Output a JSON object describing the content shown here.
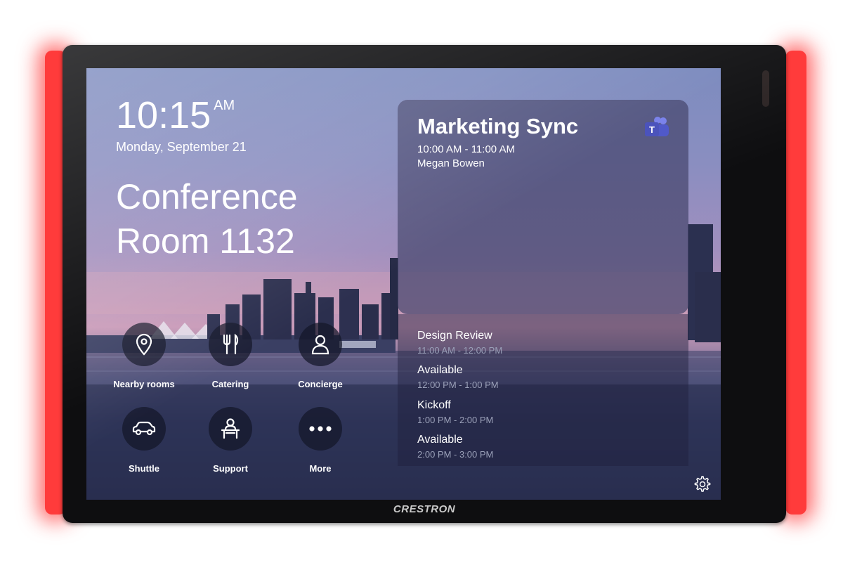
{
  "clock": {
    "time": "10:15",
    "ampm": "AM",
    "date": "Monday, September 21"
  },
  "room": {
    "line1": "Conference",
    "line2": "Room 1132"
  },
  "tiles": [
    {
      "label": "Nearby rooms",
      "icon": "map-pin-icon"
    },
    {
      "label": "Catering",
      "icon": "fork-knife-icon"
    },
    {
      "label": "Concierge",
      "icon": "person-icon"
    },
    {
      "label": "Shuttle",
      "icon": "car-icon"
    },
    {
      "label": "Support",
      "icon": "desk-person-icon"
    },
    {
      "label": "More",
      "icon": "more-dots-icon"
    }
  ],
  "current_meeting": {
    "title": "Marketing Sync",
    "time": "10:00 AM - 11:00 AM",
    "organizer": "Megan Bowen",
    "app_icon": "teams-icon"
  },
  "agenda": [
    {
      "name": "Design Review",
      "time": "11:00 AM - 12:00 PM"
    },
    {
      "name": "Available",
      "time": "12:00 PM - 1:00 PM"
    },
    {
      "name": "Kickoff",
      "time": "1:00 PM - 2:00 PM"
    },
    {
      "name": "Available",
      "time": "2:00 PM - 3:00 PM"
    }
  ],
  "device": {
    "brand": "CRESTRON",
    "led_color": "#ff3b3b"
  },
  "settings_icon": "gear-icon"
}
